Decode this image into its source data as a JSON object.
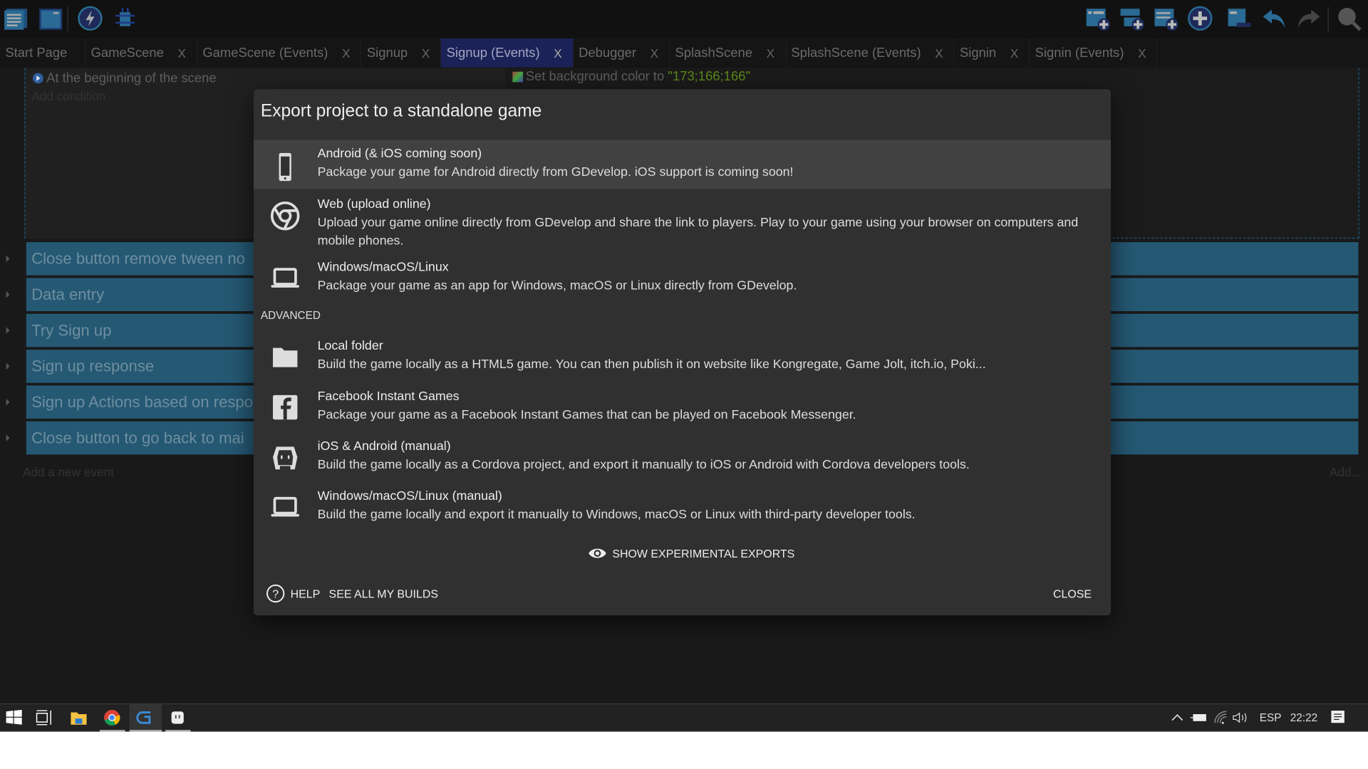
{
  "toolbar": {
    "left_icons": [
      "project-manager-icon",
      "scene-window-icon",
      "preview-lightning-icon",
      "debugger-bug-icon"
    ],
    "right_icons": [
      "add-event-icon",
      "add-sub-event-icon",
      "add-comment-icon",
      "add-group-icon",
      "delete-icon",
      "undo-icon",
      "redo-icon",
      "search-icon"
    ]
  },
  "tabs": [
    {
      "label": "Start Page",
      "closable": false
    },
    {
      "label": "GameScene",
      "closable": true
    },
    {
      "label": "GameScene (Events)",
      "closable": true
    },
    {
      "label": "Signup",
      "closable": true
    },
    {
      "label": "Signup (Events)",
      "closable": true,
      "active": true
    },
    {
      "label": "Debugger",
      "closable": true
    },
    {
      "label": "SplashScene",
      "closable": true
    },
    {
      "label": "SplashScene (Events)",
      "closable": true
    },
    {
      "label": "Signin",
      "closable": true
    },
    {
      "label": "Signin (Events)",
      "closable": true
    }
  ],
  "tab_close_glyph": "X",
  "events": {
    "condition": "At the beginning of the scene",
    "add_condition": "Add condition",
    "action_prefix": "Set background color to ",
    "action_value": "\"173;166;166\"",
    "action_value_color": "#5c8a1a",
    "groups": [
      "Close button remove tween no",
      "Data entry",
      "Try Sign up",
      "Sign up response",
      "Sign up Actions based on respo",
      "Close button to go back to mai"
    ],
    "group_color": "#255873",
    "add_event": "Add a new event",
    "add_other": "Add..."
  },
  "dialog": {
    "title": "Export project to a standalone game",
    "items": [
      {
        "icon": "phone-icon",
        "title": "Android (& iOS coming soon)",
        "desc": "Package your game for Android directly from GDevelop. iOS support is coming soon!",
        "highlighted": true
      },
      {
        "icon": "chrome-icon",
        "title": "Web (upload online)",
        "desc": "Upload your game online directly from GDevelop and share the link to players. Play to your game using your browser on computers and mobile phones."
      },
      {
        "icon": "laptop-icon",
        "title": "Windows/macOS/Linux",
        "desc": "Package your game as an app for Windows, macOS or Linux directly from GDevelop."
      }
    ],
    "advanced_label": "ADVANCED",
    "advanced_items": [
      {
        "icon": "folder-icon",
        "title": "Local folder",
        "desc": "Build the game locally as a HTML5 game. You can then publish it on website like Kongregate, Game Jolt, itch.io, Poki..."
      },
      {
        "icon": "facebook-icon",
        "title": "Facebook Instant Games",
        "desc": "Package your game as a Facebook Instant Games that can be played on Facebook Messenger."
      },
      {
        "icon": "cordova-icon",
        "title": "iOS & Android (manual)",
        "desc": "Build the game locally as a Cordova project, and export it manually to iOS or Android with Cordova developers tools."
      },
      {
        "icon": "laptop-icon",
        "title": "Windows/macOS/Linux (manual)",
        "desc": "Build the game locally and export it manually to Windows, macOS or Linux with third-party developer tools."
      }
    ],
    "show_experimental": "SHOW EXPERIMENTAL EXPORTS",
    "help": "HELP",
    "see_builds": "SEE ALL MY BUILDS",
    "close": "CLOSE"
  },
  "taskbar": {
    "apps": [
      "windows-start-icon",
      "task-view-icon",
      "file-explorer-icon",
      "chrome-icon",
      "gdevelop-icon",
      "app-icon"
    ],
    "language": "ESP",
    "time": "22:22"
  }
}
